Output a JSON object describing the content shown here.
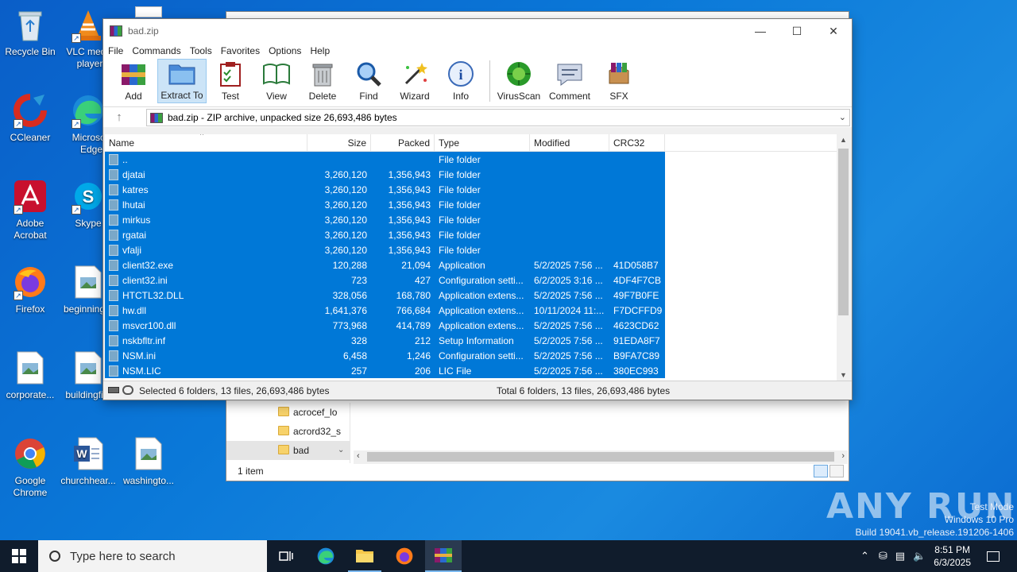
{
  "desktop": {
    "icons": [
      {
        "label": "Recycle Bin"
      },
      {
        "label": "VLC media player"
      },
      {
        "label": "CCleaner"
      },
      {
        "label": "Microsoft Edge"
      },
      {
        "label": "Adobe Acrobat"
      },
      {
        "label": "Skype"
      },
      {
        "label": "Firefox"
      },
      {
        "label": "beginning..."
      },
      {
        "label": "corporate..."
      },
      {
        "label": "buildingfi..."
      },
      {
        "label": "Google Chrome"
      },
      {
        "label": "churchhear..."
      },
      {
        "label": "washingto..."
      }
    ]
  },
  "explorer": {
    "nav_items": [
      "acrocef_lo",
      "acrord32_s",
      "bad"
    ],
    "status": "1 item"
  },
  "winrar": {
    "title": "bad.zip",
    "menu": [
      "File",
      "Commands",
      "Tools",
      "Favorites",
      "Options",
      "Help"
    ],
    "toolbar": [
      "Add",
      "Extract To",
      "Test",
      "View",
      "Delete",
      "Find",
      "Wizard",
      "Info",
      "VirusScan",
      "Comment",
      "SFX"
    ],
    "address": "bad.zip - ZIP archive, unpacked size 26,693,486 bytes",
    "columns": {
      "name": "Name",
      "size": "Size",
      "packed": "Packed",
      "type": "Type",
      "modified": "Modified",
      "crc": "CRC32"
    },
    "rows": [
      {
        "name": "..",
        "size": "",
        "packed": "",
        "type": "File folder",
        "modified": "",
        "crc": ""
      },
      {
        "name": "djatai",
        "size": "3,260,120",
        "packed": "1,356,943",
        "type": "File folder",
        "modified": "",
        "crc": ""
      },
      {
        "name": "katres",
        "size": "3,260,120",
        "packed": "1,356,943",
        "type": "File folder",
        "modified": "",
        "crc": ""
      },
      {
        "name": "lhutai",
        "size": "3,260,120",
        "packed": "1,356,943",
        "type": "File folder",
        "modified": "",
        "crc": ""
      },
      {
        "name": "mirkus",
        "size": "3,260,120",
        "packed": "1,356,943",
        "type": "File folder",
        "modified": "",
        "crc": ""
      },
      {
        "name": "rgatai",
        "size": "3,260,120",
        "packed": "1,356,943",
        "type": "File folder",
        "modified": "",
        "crc": ""
      },
      {
        "name": "vfalji",
        "size": "3,260,120",
        "packed": "1,356,943",
        "type": "File folder",
        "modified": "",
        "crc": ""
      },
      {
        "name": "client32.exe",
        "size": "120,288",
        "packed": "21,094",
        "type": "Application",
        "modified": "5/2/2025 7:56 ...",
        "crc": "41D058B7"
      },
      {
        "name": "client32.ini",
        "size": "723",
        "packed": "427",
        "type": "Configuration setti...",
        "modified": "6/2/2025 3:16 ...",
        "crc": "4DF4F7CB"
      },
      {
        "name": "HTCTL32.DLL",
        "size": "328,056",
        "packed": "168,780",
        "type": "Application extens...",
        "modified": "5/2/2025 7:56 ...",
        "crc": "49F7B0FE"
      },
      {
        "name": "hw.dll",
        "size": "1,641,376",
        "packed": "766,684",
        "type": "Application extens...",
        "modified": "10/11/2024 11:...",
        "crc": "F7DCFFD9"
      },
      {
        "name": "msvcr100.dll",
        "size": "773,968",
        "packed": "414,789",
        "type": "Application extens...",
        "modified": "5/2/2025 7:56 ...",
        "crc": "4623CD62"
      },
      {
        "name": "nskbfltr.inf",
        "size": "328",
        "packed": "212",
        "type": "Setup Information",
        "modified": "5/2/2025 7:56 ...",
        "crc": "91EDA8F7"
      },
      {
        "name": "NSM.ini",
        "size": "6,458",
        "packed": "1,246",
        "type": "Configuration setti...",
        "modified": "5/2/2025 7:56 ...",
        "crc": "B9FA7C89"
      },
      {
        "name": "NSM.LIC",
        "size": "257",
        "packed": "206",
        "type": "LIC File",
        "modified": "5/2/2025 7:56 ...",
        "crc": "380EC993"
      }
    ],
    "status_left": "Selected 6 folders, 13 files, 26,693,486 bytes",
    "status_right": "Total 6 folders, 13 files, 26,693,486 bytes"
  },
  "taskbar": {
    "search_placeholder": "Type here to search",
    "time": "8:51 PM",
    "date": "6/3/2025"
  },
  "watermark": {
    "line1": "Test Mode",
    "line2": "Windows 10 Pro",
    "line3": "Build 19041.vb_release.191206-1406",
    "brand": "ANY RUN"
  }
}
